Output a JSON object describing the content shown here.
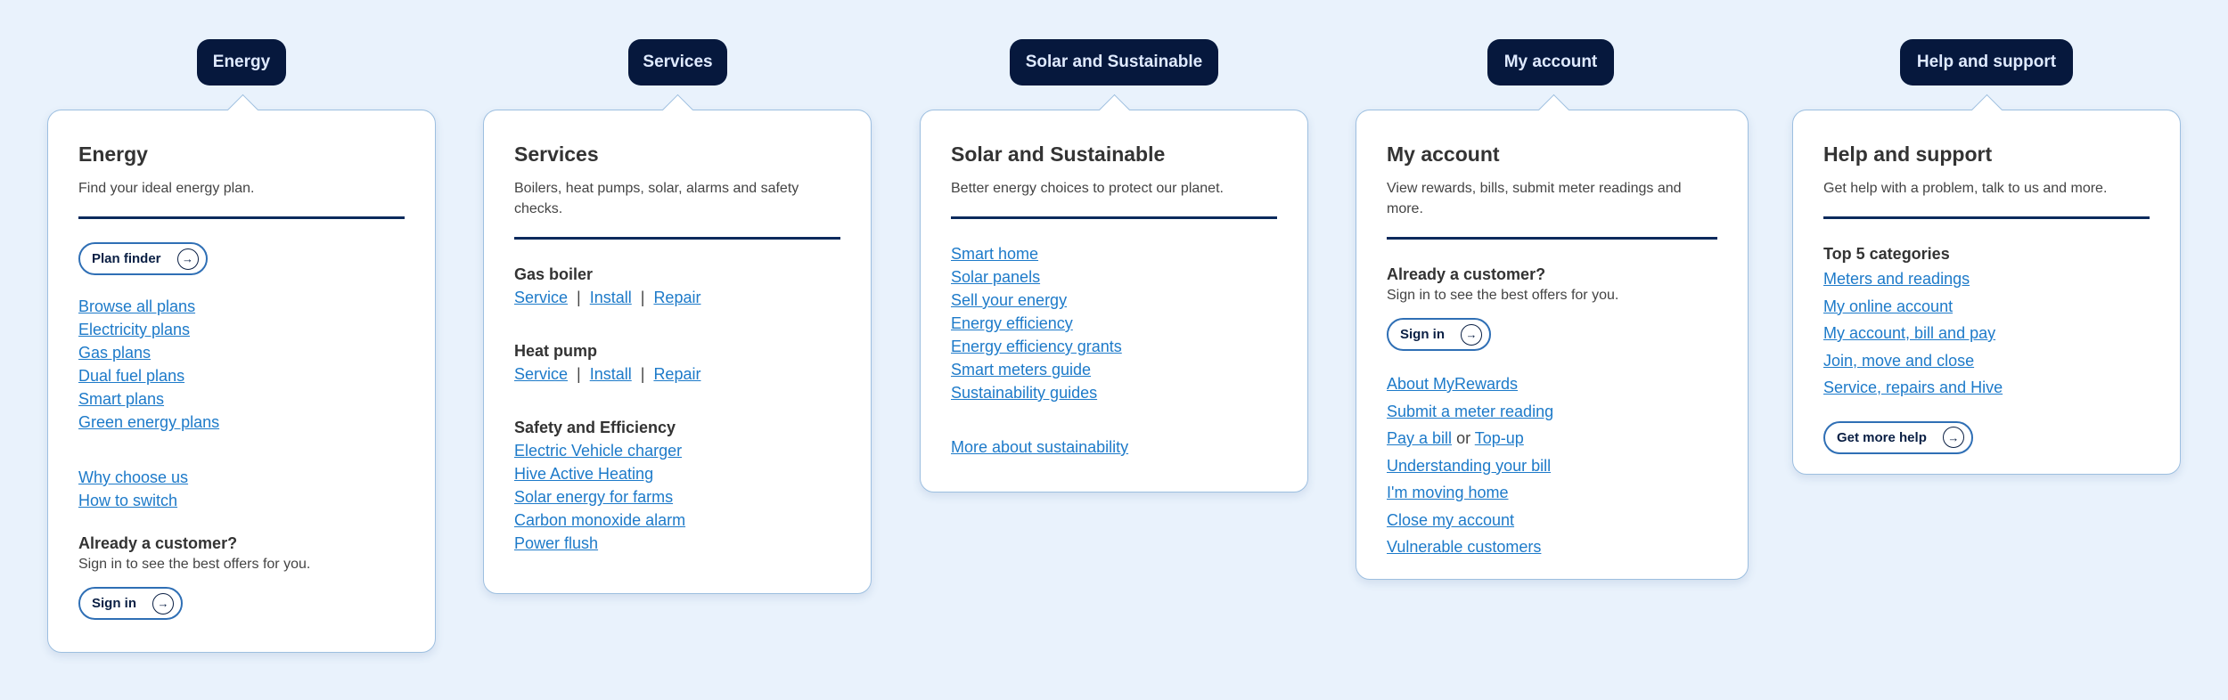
{
  "energy": {
    "tab": "Energy",
    "title": "Energy",
    "description": "Find your ideal energy plan.",
    "plan_finder": "Plan finder",
    "links": [
      "Browse all plans",
      "Electricity plans",
      "Gas plans",
      "Dual fuel plans",
      "Smart plans",
      "Green energy plans"
    ],
    "links2": [
      "Why choose us",
      "How to switch"
    ],
    "customer_heading": "Already a customer?",
    "customer_text": "Sign in to see the best offers for you.",
    "sign_in": "Sign in"
  },
  "services": {
    "tab": "Services",
    "title": "Services",
    "description": "Boilers, heat pumps, solar, alarms and safety checks.",
    "gas_boiler": {
      "heading": "Gas boiler",
      "service": "Service",
      "install": "Install",
      "repair": "Repair"
    },
    "heat_pump": {
      "heading": "Heat pump",
      "service": "Service",
      "install": "Install",
      "repair": "Repair"
    },
    "safety_heading": "Safety and Efficiency",
    "safety_links": [
      "Electric Vehicle charger",
      "Hive Active Heating",
      "Solar energy for farms",
      "Carbon monoxide alarm",
      "Power flush"
    ],
    "separator": "|"
  },
  "solar": {
    "tab": "Solar and Sustainable",
    "title": "Solar and Sustainable",
    "description": "Better energy choices to protect our planet.",
    "links": [
      "Smart home",
      "Solar panels",
      "Sell your energy",
      "Energy efficiency",
      "Energy efficiency grants",
      "Smart meters guide",
      "Sustainability guides"
    ],
    "more": "More about sustainability"
  },
  "account": {
    "tab": "My account",
    "title": "My account",
    "description": "View rewards, bills, submit meter readings and more.",
    "customer_heading": "Already a customer?",
    "customer_text": "Sign in to see the best offers for you.",
    "sign_in": "Sign in",
    "links_a": [
      "About MyRewards",
      "Submit a meter reading"
    ],
    "pay_bill": "Pay a bill",
    "or": "or",
    "top_up": "Top-up",
    "links_b": [
      "Understanding your bill",
      "I'm moving home",
      "Close my account",
      "Vulnerable customers"
    ]
  },
  "help": {
    "tab": "Help and support",
    "title": "Help and support",
    "description": "Get help with a problem, talk to us and more.",
    "categories_heading": "Top 5 categories",
    "links": [
      "Meters and readings",
      "My online account",
      "My account, bill and pay",
      "Join, move and close",
      "Service, repairs and Hive"
    ],
    "more_help": "Get more help"
  },
  "icons": {
    "arrow": "arrow-right-icon"
  },
  "colors": {
    "tab_bg": "#06183d",
    "link": "#1d7ac9",
    "divider": "#0b2a5c",
    "page_bg": "#e9f2fc"
  }
}
